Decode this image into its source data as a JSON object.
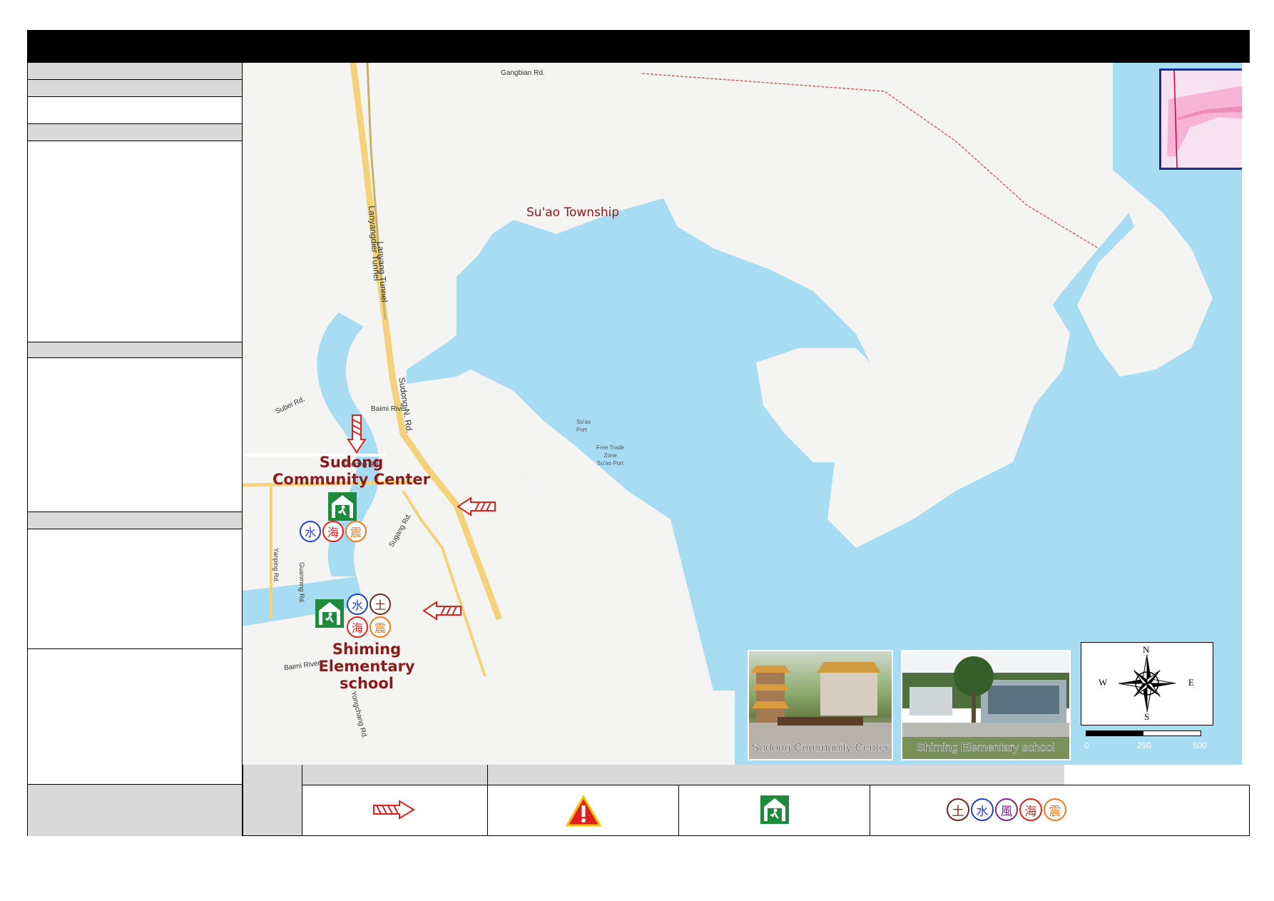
{
  "map": {
    "township_label": "Su'ao Township",
    "roads": {
      "gangbian": "Gangbian Rd.",
      "lanyang_tunnel": "Lanyang Tunnel",
      "lanyangdier_tunnel": "Lanyangdier Tunnel",
      "sudong_n": "Sudong N. Rd.",
      "sugang": "Sugang Rd.",
      "subei": "Subei Rd.",
      "baimi_river_top": "Baimi River",
      "baimi_river_bottom": "Baimi River",
      "sudong_rd": "Sudong Rd.",
      "guanming": "Guanming Rd.",
      "yanping": "Yanping Rd.",
      "yongchang": "Yongchang Rd."
    },
    "shelters": [
      {
        "name_line1": "Sudong",
        "name_line2": "Community Center",
        "hazards": [
          "水",
          "海",
          "震"
        ]
      },
      {
        "name_line1": "Shiming",
        "name_line2": "Elementary",
        "name_line3": "school",
        "hazards": [
          "水",
          "土",
          "海",
          "震"
        ]
      }
    ],
    "photo_captions": {
      "sudong": "Sudong Community Center",
      "shiming": "Shiming Elementary school"
    },
    "compass": {
      "n": "N",
      "s": "S",
      "e": "E",
      "w": "W"
    },
    "scale": {
      "ticks": [
        "0",
        "250",
        "500"
      ]
    },
    "port_labels": {
      "line1": "Su'ao",
      "line2": "Port",
      "line3": "Free Trade",
      "line4": "Zone",
      "line5": "Su'ao Port"
    }
  },
  "legend": {
    "hazard_glyphs": [
      "土",
      "水",
      "風",
      "海",
      "震"
    ]
  },
  "colors": {
    "water": "#a8dcf3",
    "land": "#f4f4f2",
    "label_red": "#8b1a1a",
    "shelter_green": "#1e8a3c",
    "arrow_red": "#e0201b",
    "tunnel_yellow": "#f3d27a",
    "inset_pink": "#f6b3d6",
    "inset_border": "#1d2f8c"
  }
}
